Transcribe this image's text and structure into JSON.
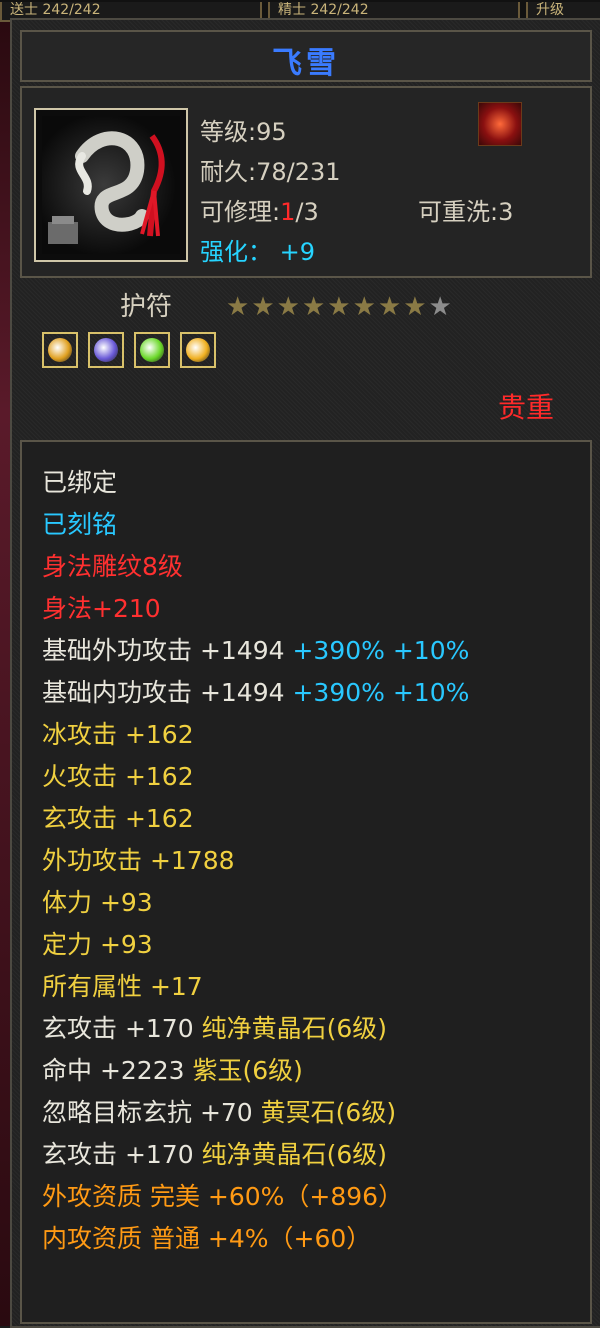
{
  "item": {
    "name": "飞雪",
    "level_label": "等级",
    "level": "95",
    "durability_label": "耐久",
    "durability": "78/231",
    "repair_label": "可修理",
    "repair_used": "1",
    "repair_total": "/3",
    "rewash_label": "可重洗",
    "rewash": "3",
    "enhance_label": "强化：",
    "enhance": "+9",
    "type": "护符",
    "rarity": "贵重",
    "stars_filled": 8,
    "stars_total": 9
  },
  "gems": [
    {
      "name": "gem-orange",
      "color": "#e0a020"
    },
    {
      "name": "gem-purple",
      "color": "#6a5ad8"
    },
    {
      "name": "gem-green",
      "color": "#6ad828"
    },
    {
      "name": "gem-gold",
      "color": "#f0b020"
    }
  ],
  "attributes": [
    {
      "segments": [
        {
          "text": "已绑定",
          "style": "c-white"
        }
      ]
    },
    {
      "segments": [
        {
          "text": "已刻铭",
          "style": "c-cyan"
        }
      ]
    },
    {
      "segments": [
        {
          "text": "身法雕纹8级",
          "style": "c-red"
        }
      ]
    },
    {
      "segments": [
        {
          "text": "身法+210",
          "style": "c-red"
        }
      ]
    },
    {
      "segments": [
        {
          "text": "基础外功攻击 +1494 ",
          "style": "c-white"
        },
        {
          "text": "+390% +10%",
          "style": "c-cyan"
        }
      ]
    },
    {
      "segments": [
        {
          "text": "基础内功攻击 +1494 ",
          "style": "c-white"
        },
        {
          "text": "+390% +10%",
          "style": "c-cyan"
        }
      ]
    },
    {
      "segments": [
        {
          "text": "冰攻击 +162",
          "style": "c-gold"
        }
      ]
    },
    {
      "segments": [
        {
          "text": "火攻击 +162",
          "style": "c-gold"
        }
      ]
    },
    {
      "segments": [
        {
          "text": "玄攻击 +162",
          "style": "c-gold"
        }
      ]
    },
    {
      "segments": [
        {
          "text": "外功攻击 +1788",
          "style": "c-gold"
        }
      ]
    },
    {
      "segments": [
        {
          "text": "体力 +93",
          "style": "c-gold"
        }
      ]
    },
    {
      "segments": [
        {
          "text": "定力 +93",
          "style": "c-gold"
        }
      ]
    },
    {
      "segments": [
        {
          "text": "所有属性 +17",
          "style": "c-gold"
        }
      ]
    },
    {
      "segments": [
        {
          "text": "玄攻击 +170 ",
          "style": "c-white"
        },
        {
          "text": "纯净黄晶石(6级)",
          "style": "c-gold"
        }
      ]
    },
    {
      "segments": [
        {
          "text": "命中 +2223 ",
          "style": "c-white"
        },
        {
          "text": "紫玉(6级)",
          "style": "c-gold"
        }
      ]
    },
    {
      "segments": [
        {
          "text": "忽略目标玄抗 +70 ",
          "style": "c-white"
        },
        {
          "text": "黄冥石(6级)",
          "style": "c-gold"
        }
      ]
    },
    {
      "segments": [
        {
          "text": "玄攻击 +170 ",
          "style": "c-white"
        },
        {
          "text": "纯净黄晶石(6级)",
          "style": "c-gold"
        }
      ]
    },
    {
      "segments": [
        {
          "text": "外攻资质  完美 +60%（+896）",
          "style": "c-orange"
        }
      ]
    },
    {
      "segments": [
        {
          "text": "内攻资质  普通 +4%（+60）",
          "style": "c-orange"
        }
      ]
    }
  ],
  "top_strip": [
    "送士 242/242",
    "精士 242/242",
    "升级"
  ]
}
